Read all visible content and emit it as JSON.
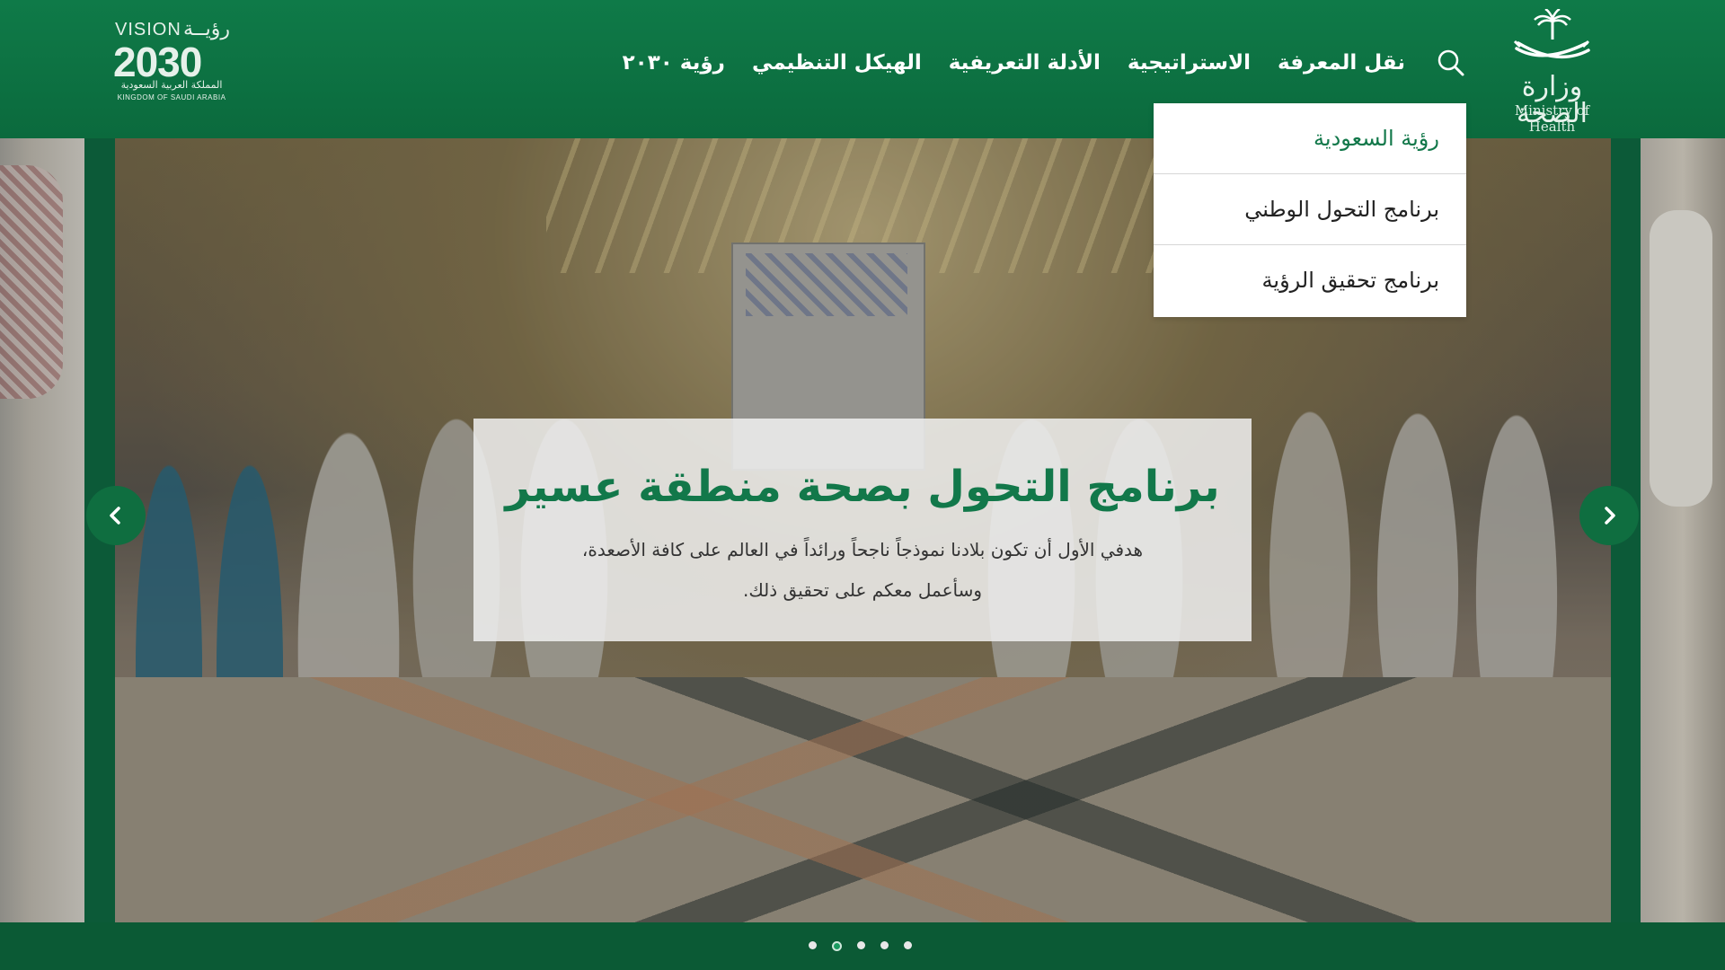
{
  "header": {
    "moh_logo": {
      "name_ar": "وزارة الصحة",
      "name_en": "Ministry of Health"
    },
    "vision_logo": {
      "label_en": "VISION",
      "label_ar": "رؤيــة",
      "year": "2030",
      "kingdom_ar": "المملكة العربية السعودية",
      "kingdom_en": "KINGDOM OF SAUDI ARABIA"
    },
    "nav": [
      {
        "label": "رؤية ٢٠٣٠"
      },
      {
        "label": "الهيكل التنظيمي"
      },
      {
        "label": "الأدلة التعريفية"
      },
      {
        "label": "الاستراتيجية"
      },
      {
        "label": "نقل المعرفة"
      }
    ],
    "search_icon": "search-icon"
  },
  "dropdown": {
    "items": [
      {
        "label": "رؤية السعودية",
        "active": true
      },
      {
        "label": "برنامج التحول الوطني",
        "active": false
      },
      {
        "label": "برنامج تحقيق الرؤية",
        "active": false
      }
    ]
  },
  "slider": {
    "caption_title": "برنامج التحول بصحة منطقة عسير",
    "caption_text": "هدفي الأول أن تكون بلادنا نموذجاً ناجحاً ورائداً في العالم على كافة الأصعدة، وسأعمل معكم على تحقيق ذلك.",
    "prev_icon": "chevron-left-icon",
    "next_icon": "chevron-right-icon",
    "dots_count": 5,
    "active_dot": 2
  },
  "colors": {
    "brand_green": "#0f7a48",
    "title_green": "#12784a",
    "arrow_green": "#0f6e40"
  }
}
